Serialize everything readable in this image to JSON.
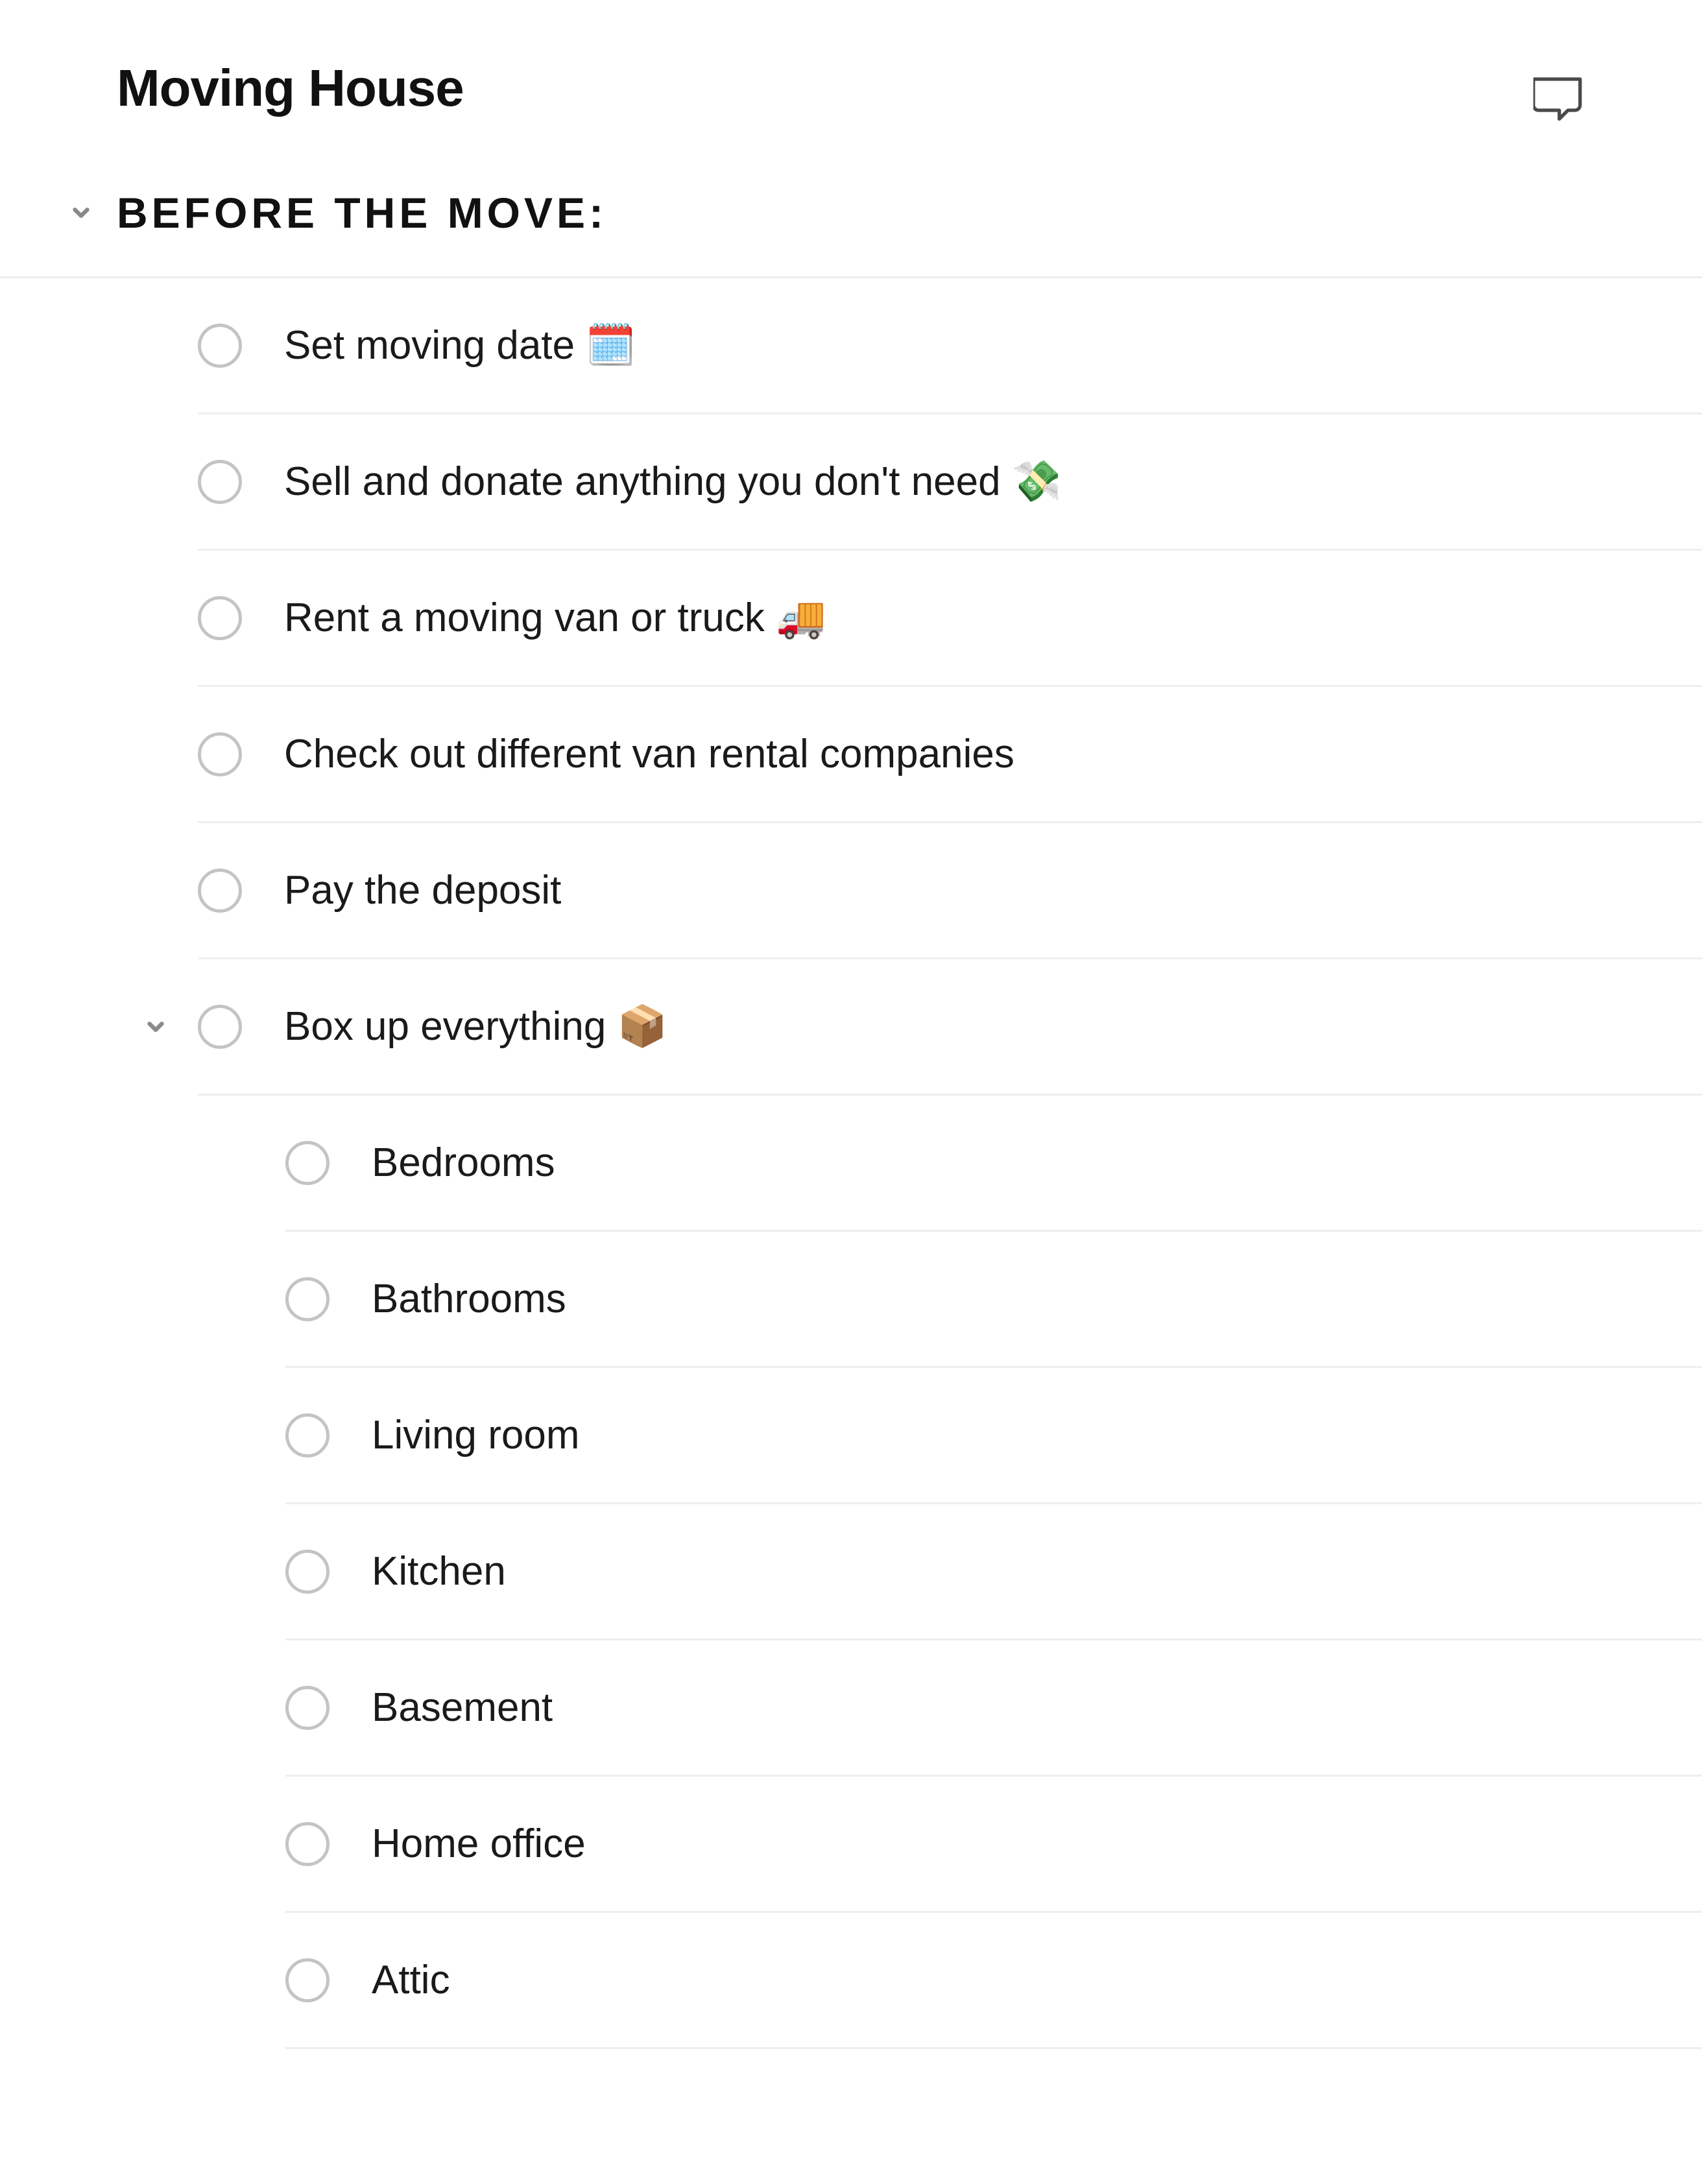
{
  "page": {
    "title": "Moving House"
  },
  "section": {
    "title": "BEFORE THE MOVE",
    "suffix": ":"
  },
  "tasks": {
    "level1": [
      {
        "label": "Set moving date 🗓️"
      },
      {
        "label": "Sell and donate anything you don't need 💸"
      },
      {
        "label": "Rent a moving van or truck 🚚"
      },
      {
        "label": "Check out different van rental companies"
      },
      {
        "label": "Pay the deposit"
      },
      {
        "label": "Box up everything 📦"
      }
    ],
    "level2": [
      {
        "label": "Bedrooms"
      },
      {
        "label": "Bathrooms"
      },
      {
        "label": "Living room"
      },
      {
        "label": "Kitchen"
      },
      {
        "label": "Basement"
      },
      {
        "label": "Home office"
      },
      {
        "label": "Attic"
      }
    ]
  }
}
